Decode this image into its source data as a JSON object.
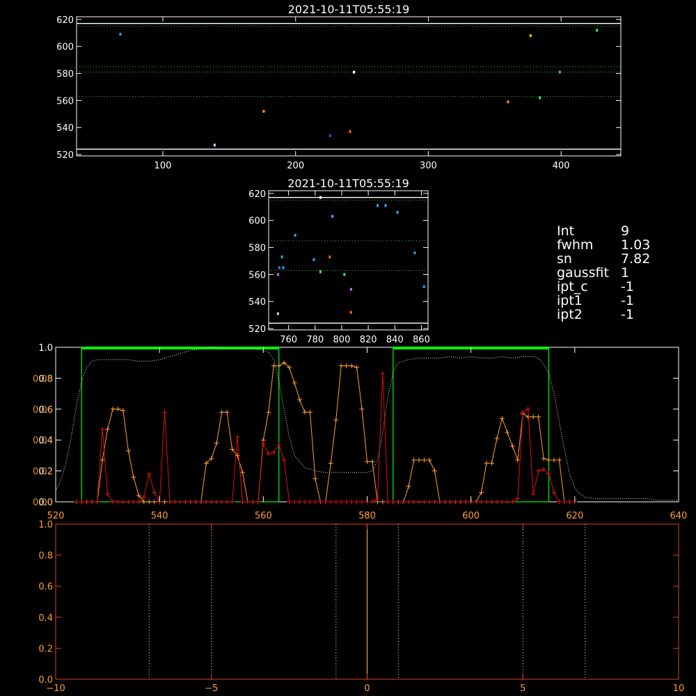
{
  "colors": {
    "background": "#000000",
    "axis": "#ffffff",
    "grid": "#33cc33",
    "profile_green": "#00ff00",
    "dotted_profile": "#ccffcc",
    "orange": "#ffa030",
    "red": "#e01010",
    "bottom_axis": "#e04020",
    "bottom_grid": "#ffff80"
  },
  "info_panel": [
    {
      "key": "Int",
      "value": "9"
    },
    {
      "key": "fwhm",
      "value": "1.03"
    },
    {
      "key": "sn",
      "value": "7.82"
    },
    {
      "key": "gaussfit",
      "value": "1"
    },
    {
      "key": "ipt_c",
      "value": "-1"
    },
    {
      "key": "ipt1",
      "value": "-1"
    },
    {
      "key": "ipt2",
      "value": "-1"
    }
  ],
  "chart_data": [
    {
      "id": "top-scatter",
      "type": "scatter",
      "title": "2021-10-11T05:55:19",
      "xlim": [
        35,
        445
      ],
      "ylim": [
        519,
        622
      ],
      "xticks": [
        100,
        200,
        300,
        400
      ],
      "yticks": [
        520,
        540,
        560,
        580,
        600,
        620
      ],
      "hlines_solid": [
        617,
        524
      ],
      "hlines_dotted": [
        615,
        585,
        581,
        563
      ],
      "points": [
        {
          "x": 68,
          "y": 609,
          "color": "#22aaff"
        },
        {
          "x": 139,
          "y": 527,
          "color": "#ccccff"
        },
        {
          "x": 176,
          "y": 552,
          "color": "#ff9900"
        },
        {
          "x": 226,
          "y": 534,
          "color": "#4444ff"
        },
        {
          "x": 241,
          "y": 537,
          "color": "#ff6600"
        },
        {
          "x": 244,
          "y": 581,
          "color": "#ffffff"
        },
        {
          "x": 360,
          "y": 559,
          "color": "#ff9900"
        },
        {
          "x": 377,
          "y": 608,
          "color": "#ffcc00"
        },
        {
          "x": 384,
          "y": 562,
          "color": "#33ff66"
        },
        {
          "x": 399,
          "y": 581,
          "color": "#22aaff"
        },
        {
          "x": 427,
          "y": 612,
          "color": "#33ff33"
        }
      ]
    },
    {
      "id": "middle-scatter",
      "type": "scatter",
      "title": "2021-10-11T05:55:19",
      "xlim": [
        745,
        865
      ],
      "ylim": [
        519,
        622
      ],
      "xticks": [
        760,
        780,
        800,
        820,
        840,
        860
      ],
      "yticks": [
        520,
        540,
        560,
        580,
        600,
        620
      ],
      "hlines_solid": [
        617,
        524
      ],
      "hlines_dotted": [
        615,
        585,
        563
      ],
      "points": [
        {
          "x": 752,
          "y": 531,
          "color": "#ccccff"
        },
        {
          "x": 752,
          "y": 560,
          "color": "#cc66ff"
        },
        {
          "x": 753,
          "y": 565,
          "color": "#6666ff"
        },
        {
          "x": 755,
          "y": 573,
          "color": "#22aaff"
        },
        {
          "x": 756,
          "y": 565,
          "color": "#22aaff"
        },
        {
          "x": 765,
          "y": 589,
          "color": "#22aaff"
        },
        {
          "x": 779,
          "y": 571,
          "color": "#22aaff"
        },
        {
          "x": 784,
          "y": 617,
          "color": "#ffffff"
        },
        {
          "x": 784,
          "y": 562,
          "color": "#33ff66"
        },
        {
          "x": 791,
          "y": 573,
          "color": "#ff6600"
        },
        {
          "x": 793,
          "y": 603,
          "color": "#cc66ff"
        },
        {
          "x": 802,
          "y": 560,
          "color": "#33ff66"
        },
        {
          "x": 807,
          "y": 549,
          "color": "#cc66ff"
        },
        {
          "x": 807,
          "y": 532,
          "color": "#ff6600"
        },
        {
          "x": 827,
          "y": 611,
          "color": "#22aaff"
        },
        {
          "x": 833,
          "y": 611,
          "color": "#22aaff"
        },
        {
          "x": 842,
          "y": 606,
          "color": "#22aaff"
        },
        {
          "x": 855,
          "y": 576,
          "color": "#22aaff"
        },
        {
          "x": 862,
          "y": 551,
          "color": "#22aaff"
        }
      ]
    },
    {
      "id": "profile-plot",
      "type": "line",
      "xlim": [
        520,
        640
      ],
      "ylim": [
        0,
        1
      ],
      "xticks": [
        520,
        540,
        560,
        580,
        600,
        620,
        640
      ],
      "yticks_left_white": [
        "0.0",
        "0.2",
        "0.4",
        "0.6",
        "0.8",
        "1.0"
      ],
      "yticks_left_white_values": [
        0,
        0.2,
        0.4,
        0.6,
        0.8,
        1.0
      ],
      "yticks_left_orange": [
        "0.00",
        "0.02",
        "0.04",
        "0.06",
        "0.08"
      ],
      "yticks_left_orange_values": [
        0,
        0.2,
        0.4,
        0.6,
        0.8
      ],
      "windows": [
        [
          525,
          563
        ],
        [
          585,
          615
        ]
      ],
      "window_top": 1.0,
      "dotted_profile": {
        "x": [
          520,
          521,
          522,
          523,
          524,
          525,
          526,
          527,
          528,
          530,
          532,
          534,
          536,
          538,
          540,
          542,
          544,
          546,
          548,
          550,
          552,
          554,
          556,
          558,
          560,
          561,
          562,
          563,
          564,
          565,
          566,
          568,
          570,
          572,
          574,
          576,
          578,
          580,
          581,
          582,
          583,
          584,
          585,
          586,
          588,
          590,
          592,
          594,
          596,
          598,
          600,
          602,
          604,
          606,
          608,
          610,
          612,
          613,
          614,
          615,
          616,
          617,
          618,
          619,
          620,
          621,
          622,
          624,
          626,
          628,
          630,
          632,
          634,
          636,
          638,
          640
        ],
        "y": [
          0.07,
          0.14,
          0.25,
          0.42,
          0.62,
          0.78,
          0.87,
          0.91,
          0.92,
          0.92,
          0.92,
          0.92,
          0.91,
          0.91,
          0.92,
          0.94,
          0.96,
          0.98,
          0.99,
          1.0,
          0.99,
          0.99,
          0.99,
          0.99,
          0.98,
          0.97,
          0.92,
          0.78,
          0.6,
          0.42,
          0.3,
          0.22,
          0.2,
          0.19,
          0.19,
          0.19,
          0.19,
          0.19,
          0.2,
          0.27,
          0.45,
          0.68,
          0.84,
          0.9,
          0.92,
          0.93,
          0.93,
          0.93,
          0.94,
          0.93,
          0.94,
          0.93,
          0.93,
          0.94,
          0.93,
          0.94,
          0.94,
          0.93,
          0.89,
          0.83,
          0.7,
          0.52,
          0.34,
          0.18,
          0.09,
          0.05,
          0.03,
          0.02,
          0.02,
          0.02,
          0.02,
          0.02,
          0.02,
          0.01,
          0.01,
          0.01
        ]
      },
      "orange_series": {
        "x": [
          524,
          525,
          526,
          527,
          528,
          529,
          530,
          531,
          532,
          533,
          534,
          535,
          536,
          537,
          538,
          539,
          540,
          541,
          542,
          543,
          544,
          545,
          546,
          547,
          548,
          549,
          550,
          551,
          552,
          553,
          554,
          555,
          556,
          557,
          558,
          559,
          560,
          561,
          562,
          563,
          564,
          565,
          566,
          567,
          568,
          569,
          570,
          571,
          572,
          573,
          574,
          575,
          576,
          577,
          578,
          579,
          580,
          581,
          582,
          583,
          584,
          585,
          586,
          587,
          588,
          589,
          590,
          591,
          592,
          593,
          594,
          595,
          596,
          597,
          598,
          599,
          600,
          601,
          602,
          603,
          604,
          605,
          606,
          607,
          608,
          609,
          610,
          611,
          612,
          613,
          614,
          615,
          616,
          617,
          618,
          619,
          620
        ],
        "y": [
          0,
          0,
          0,
          0,
          0,
          0.27,
          0.47,
          0.6,
          0.6,
          0.59,
          0.33,
          0.16,
          0.04,
          0,
          0,
          0,
          0,
          0,
          0,
          0,
          0,
          0,
          0,
          0,
          0,
          0.25,
          0.28,
          0.38,
          0.58,
          0.58,
          0.34,
          0.3,
          0.19,
          0,
          0,
          0,
          0.4,
          0.58,
          0.88,
          0.88,
          0.9,
          0.87,
          0.77,
          0.66,
          0.58,
          0.58,
          0.15,
          0,
          0,
          0.25,
          0.53,
          0.88,
          0.88,
          0.88,
          0.87,
          0.6,
          0.26,
          0.26,
          0,
          0,
          0,
          0,
          0,
          0,
          0.1,
          0.27,
          0.27,
          0.27,
          0.27,
          0.2,
          0,
          0,
          0,
          0,
          0,
          0,
          0,
          0,
          0.06,
          0.25,
          0.25,
          0.41,
          0.54,
          0.45,
          0.36,
          0.27,
          0.57,
          0.55,
          0.55,
          0.55,
          0.28,
          0.27,
          0.27,
          0.27,
          0,
          0,
          0
        ]
      },
      "red_series": {
        "x": [
          524,
          525,
          526,
          527,
          528,
          529,
          530,
          531,
          532,
          533,
          534,
          535,
          536,
          537,
          538,
          539,
          540,
          541,
          542,
          543,
          544,
          545,
          546,
          547,
          548,
          549,
          550,
          551,
          552,
          553,
          554,
          555,
          556,
          557,
          558,
          559,
          560,
          561,
          562,
          563,
          564,
          565,
          566,
          567,
          568,
          569,
          570,
          571,
          572,
          573,
          574,
          575,
          576,
          577,
          578,
          579,
          580,
          581,
          582,
          583,
          584,
          585,
          586,
          587,
          588,
          589,
          590,
          591,
          592,
          593,
          594,
          595,
          596,
          597,
          598,
          599,
          600,
          601,
          602,
          603,
          604,
          605,
          606,
          607,
          608,
          609,
          610,
          611,
          612,
          613,
          614,
          615,
          616,
          617,
          618,
          619,
          620
        ],
        "y": [
          0,
          0,
          0,
          0,
          0,
          0.47,
          0.05,
          0,
          0,
          0,
          0,
          0,
          0,
          0.03,
          0.18,
          0.06,
          0,
          0.58,
          0,
          0,
          0,
          0,
          0,
          0,
          0,
          0,
          0,
          0,
          0,
          0,
          0,
          0.42,
          0,
          0,
          0,
          0,
          0.38,
          0.31,
          0.32,
          0.37,
          0.27,
          0,
          0,
          0,
          0,
          0,
          0,
          0,
          0,
          0,
          0,
          0,
          0,
          0,
          0,
          0,
          0,
          0,
          0.02,
          0.83,
          0,
          0,
          0,
          0,
          0,
          0,
          0,
          0,
          0,
          0,
          0,
          0,
          0,
          0,
          0,
          0,
          0,
          0,
          0,
          0,
          0,
          0,
          0,
          0,
          0,
          0.02,
          0.58,
          0.6,
          0.05,
          0.2,
          0.21,
          0.18,
          0.06,
          0,
          0,
          0,
          0
        ]
      }
    },
    {
      "id": "bottom-plot",
      "type": "line",
      "xlim": [
        -10,
        10
      ],
      "ylim": [
        0,
        1
      ],
      "xticks": [
        -10,
        -5,
        0,
        5,
        10
      ],
      "xtick_labels": [
        "−10",
        "−5",
        "0",
        "5",
        "10"
      ],
      "yticks": [
        "0.0",
        "0.2",
        "0.4",
        "0.6",
        "0.8",
        "1.0"
      ],
      "ytick_values": [
        0,
        0.2,
        0.4,
        0.6,
        0.8,
        1.0
      ],
      "dotted_vlines": [
        -7,
        -5,
        -1,
        1,
        5,
        7
      ],
      "solid_vline": 0
    }
  ]
}
